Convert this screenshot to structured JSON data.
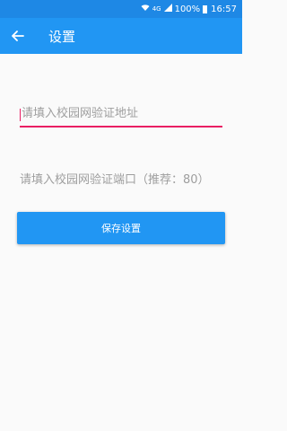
{
  "status_bar": {
    "signal_text": "4G",
    "battery": "100%",
    "time": "16:57"
  },
  "app_bar": {
    "title": "设置"
  },
  "form": {
    "address_placeholder": "请填入校园网验证地址",
    "port_placeholder": "请填入校园网验证端口（推荐：80）",
    "save_label": "保存设置"
  },
  "colors": {
    "primary": "#2196f3",
    "status_bar": "#1e88e5",
    "accent": "#e91e63"
  }
}
